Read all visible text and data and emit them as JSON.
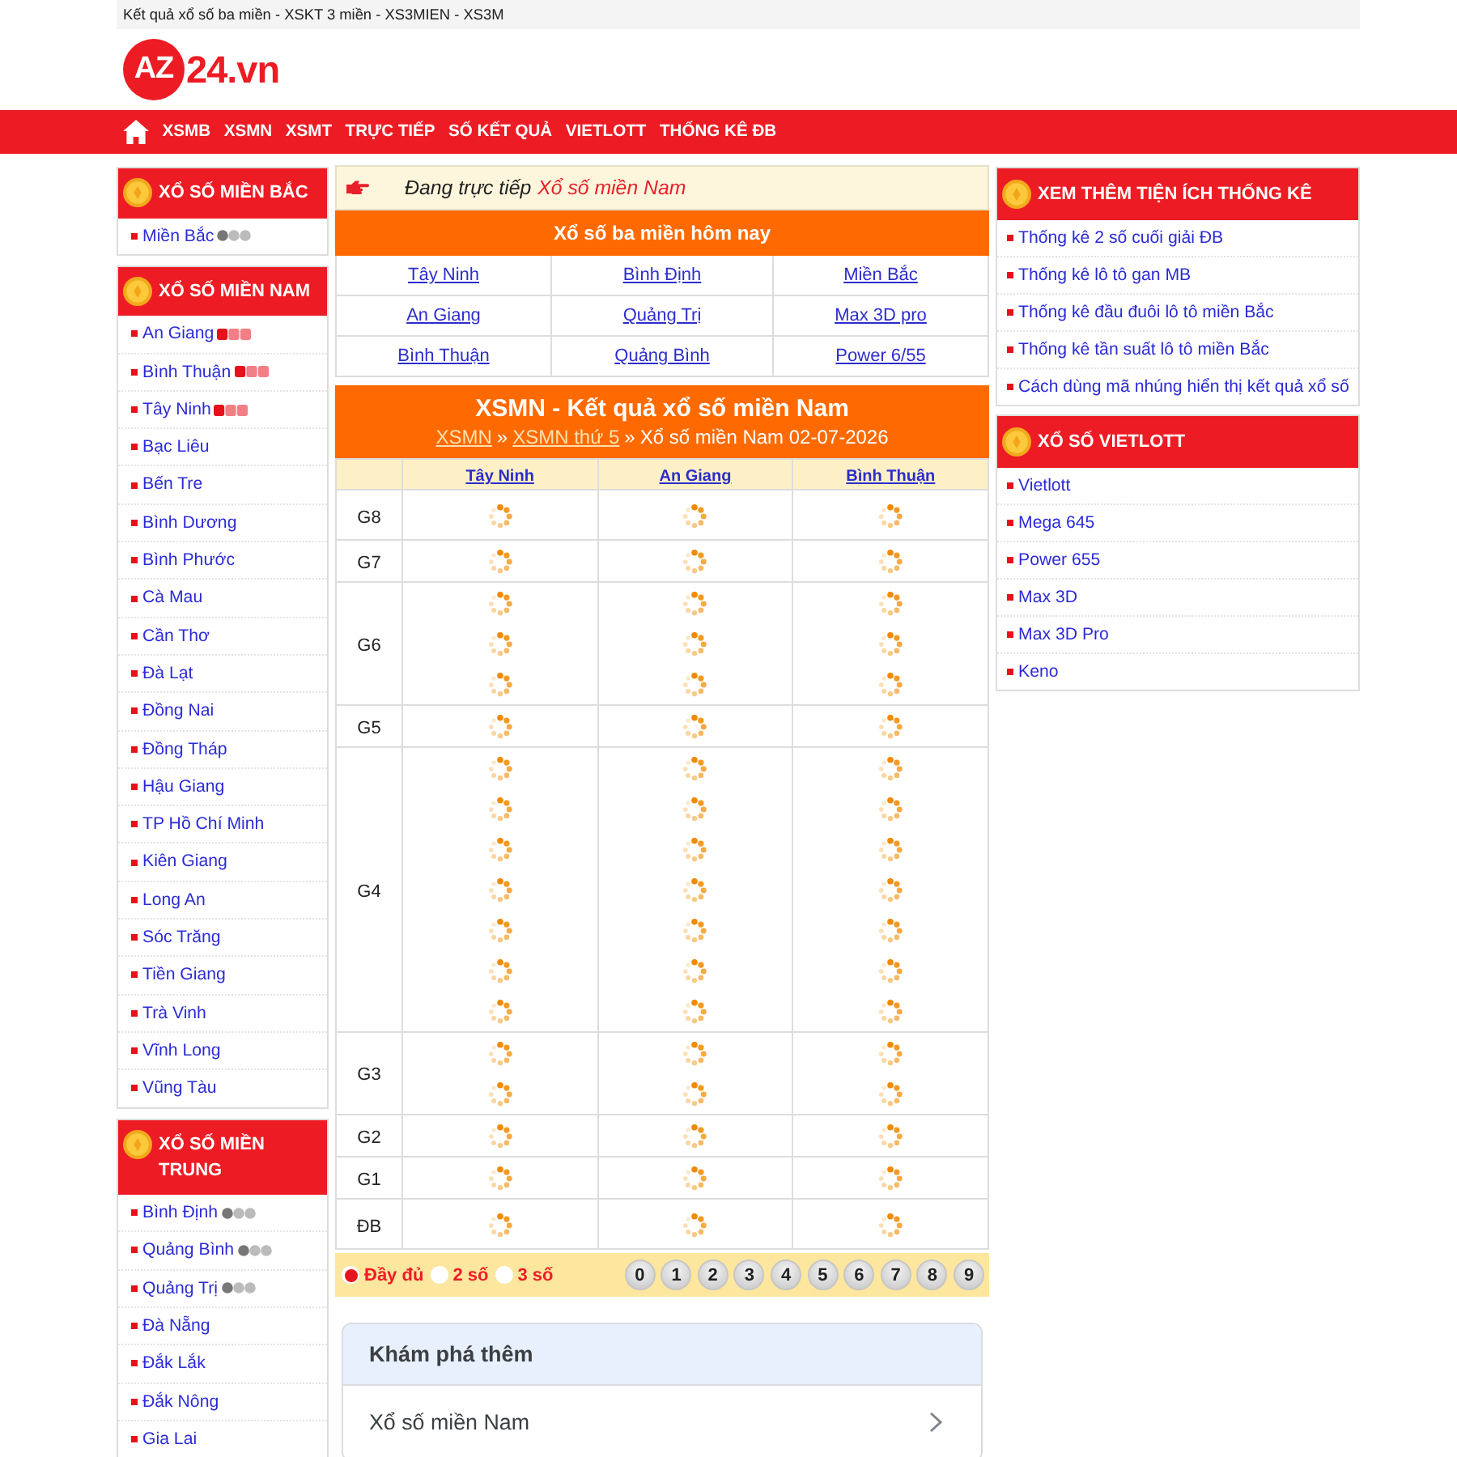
{
  "top_bar": {
    "text": "Kết quả xổ số ba miền - XSKT 3 miền - XS3MIEN - XS3M"
  },
  "logo": {
    "badge": "AZ",
    "text": "24.vn"
  },
  "nav": [
    "XSMB",
    "XSMN",
    "XSMT",
    "TRỰC TIẾP",
    "SỐ KẾT QUẢ",
    "VIETLOTT",
    "THỐNG KÊ ĐB"
  ],
  "left_sidebar": [
    {
      "title": "XỔ SỐ MIỀN BẮC",
      "items": [
        {
          "label": "Miền Bắc",
          "kind": "waiting"
        }
      ]
    },
    {
      "title": "XỔ SỐ MIỀN NAM",
      "items": [
        {
          "label": "An Giang",
          "kind": "live"
        },
        {
          "label": "Bình Thuận",
          "kind": "live"
        },
        {
          "label": "Tây Ninh",
          "kind": "live"
        },
        {
          "label": "Bạc Liêu",
          "kind": "plain"
        },
        {
          "label": "Bến Tre",
          "kind": "plain"
        },
        {
          "label": "Bình Dương",
          "kind": "plain"
        },
        {
          "label": "Bình Phước",
          "kind": "plain"
        },
        {
          "label": "Cà Mau",
          "kind": "plain"
        },
        {
          "label": "Cần Thơ",
          "kind": "plain"
        },
        {
          "label": "Đà Lạt",
          "kind": "plain"
        },
        {
          "label": "Đồng Nai",
          "kind": "plain"
        },
        {
          "label": "Đồng Tháp",
          "kind": "plain"
        },
        {
          "label": "Hậu Giang",
          "kind": "plain"
        },
        {
          "label": "TP Hồ Chí Minh",
          "kind": "plain"
        },
        {
          "label": "Kiên Giang",
          "kind": "plain"
        },
        {
          "label": "Long An",
          "kind": "plain"
        },
        {
          "label": "Sóc Trăng",
          "kind": "plain"
        },
        {
          "label": "Tiền Giang",
          "kind": "plain"
        },
        {
          "label": "Trà Vinh",
          "kind": "plain"
        },
        {
          "label": "Vĩnh Long",
          "kind": "plain"
        },
        {
          "label": "Vũng Tàu",
          "kind": "plain"
        }
      ]
    },
    {
      "title": "XỔ SỐ MIỀN TRUNG",
      "items": [
        {
          "label": "Bình Định",
          "kind": "waiting"
        },
        {
          "label": "Quảng Bình",
          "kind": "waiting"
        },
        {
          "label": "Quảng Trị",
          "kind": "waiting"
        },
        {
          "label": "Đà Nẵng",
          "kind": "plain"
        },
        {
          "label": "Đắk Lắk",
          "kind": "plain"
        },
        {
          "label": "Đắk Nông",
          "kind": "plain"
        },
        {
          "label": "Gia Lai",
          "kind": "plain"
        }
      ]
    }
  ],
  "live_banner": {
    "prefix": "Đang trực tiếp",
    "link": "Xổ số miền Nam"
  },
  "today": {
    "title": "Xổ số ba miền hôm nay",
    "links": [
      "Tây Ninh",
      "Bình Định",
      "Miền Bắc",
      "An Giang",
      "Quảng Trị",
      "Max 3D pro",
      "Bình Thuận",
      "Quảng Bình",
      "Power 6/55"
    ]
  },
  "results": {
    "title": "XSMN - Kết quả xổ số miền Nam",
    "breadcrumb": [
      {
        "kind": "link",
        "label": "XSMN"
      },
      {
        "kind": "separator",
        "label": "»"
      },
      {
        "kind": "link",
        "label": "XSMN thứ 5"
      },
      {
        "kind": "separator",
        "label": "»"
      },
      {
        "kind": "text",
        "label": "Xổ số miền Nam 02-07-2026"
      }
    ],
    "columns": [
      "Tây Ninh",
      "An Giang",
      "Bình Thuận"
    ],
    "prizes": [
      {
        "label": "G8",
        "cells": [
          {
            "slots": [
              {
                "loading": true
              }
            ]
          },
          {
            "slots": [
              {
                "loading": true
              }
            ]
          },
          {
            "slots": [
              {
                "loading": true
              }
            ]
          }
        ]
      },
      {
        "label": "G7",
        "cells": [
          {
            "slots": [
              {
                "loading": true
              }
            ]
          },
          {
            "slots": [
              {
                "loading": true
              }
            ]
          },
          {
            "slots": [
              {
                "loading": true
              }
            ]
          }
        ]
      },
      {
        "label": "G6",
        "cells": [
          {
            "slots": [
              {
                "loading": true
              },
              {
                "loading": true
              },
              {
                "loading": true
              }
            ]
          },
          {
            "slots": [
              {
                "loading": true
              },
              {
                "loading": true
              },
              {
                "loading": true
              }
            ]
          },
          {
            "slots": [
              {
                "loading": true
              },
              {
                "loading": true
              },
              {
                "loading": true
              }
            ]
          }
        ]
      },
      {
        "label": "G5",
        "cells": [
          {
            "slots": [
              {
                "loading": true
              }
            ]
          },
          {
            "slots": [
              {
                "loading": true
              }
            ]
          },
          {
            "slots": [
              {
                "loading": true
              }
            ]
          }
        ]
      },
      {
        "label": "G4",
        "cells": [
          {
            "slots": [
              {
                "loading": true
              },
              {
                "loading": true
              },
              {
                "loading": true
              },
              {
                "loading": true
              },
              {
                "loading": true
              },
              {
                "loading": true
              },
              {
                "loading": true
              }
            ]
          },
          {
            "slots": [
              {
                "loading": true
              },
              {
                "loading": true
              },
              {
                "loading": true
              },
              {
                "loading": true
              },
              {
                "loading": true
              },
              {
                "loading": true
              },
              {
                "loading": true
              }
            ]
          },
          {
            "slots": [
              {
                "loading": true
              },
              {
                "loading": true
              },
              {
                "loading": true
              },
              {
                "loading": true
              },
              {
                "loading": true
              },
              {
                "loading": true
              },
              {
                "loading": true
              }
            ]
          }
        ]
      },
      {
        "label": "G3",
        "cells": [
          {
            "slots": [
              {
                "loading": true
              },
              {
                "loading": true
              }
            ]
          },
          {
            "slots": [
              {
                "loading": true
              },
              {
                "loading": true
              }
            ]
          },
          {
            "slots": [
              {
                "loading": true
              },
              {
                "loading": true
              }
            ]
          }
        ]
      },
      {
        "label": "G2",
        "cells": [
          {
            "slots": [
              {
                "loading": true
              }
            ]
          },
          {
            "slots": [
              {
                "loading": true
              }
            ]
          },
          {
            "slots": [
              {
                "loading": true
              }
            ]
          }
        ]
      },
      {
        "label": "G1",
        "cells": [
          {
            "slots": [
              {
                "loading": true
              }
            ]
          },
          {
            "slots": [
              {
                "loading": true
              }
            ]
          },
          {
            "slots": [
              {
                "loading": true
              }
            ]
          }
        ]
      },
      {
        "label": "ĐB",
        "cells": [
          {
            "slots": [
              {
                "loading": true
              }
            ]
          },
          {
            "slots": [
              {
                "loading": true
              }
            ]
          },
          {
            "slots": [
              {
                "loading": true
              }
            ]
          }
        ]
      }
    ]
  },
  "controls": {
    "modes": [
      {
        "label": "Đầy đủ",
        "selected": true
      },
      {
        "label": "2 số",
        "selected": false
      },
      {
        "label": "3 số",
        "selected": false
      }
    ],
    "digits": [
      "0",
      "1",
      "2",
      "3",
      "4",
      "5",
      "6",
      "7",
      "8",
      "9"
    ]
  },
  "explore": {
    "title": "Khám phá thêm",
    "items": [
      "Xổ số miền Nam"
    ]
  },
  "right_sidebar": [
    {
      "title": "XEM THÊM TIỆN ÍCH THỐNG KÊ",
      "items": [
        {
          "label": "Thống kê 2 số cuối giải ĐB"
        },
        {
          "label": "Thống kê lô tô gan MB"
        },
        {
          "label": "Thống kê đầu đuôi lô tô miền Bắc"
        },
        {
          "label": "Thống kê tần suất lô tô miền Bắc"
        },
        {
          "label": "Cách dùng mã nhúng hiển thị kết quả xổ số"
        }
      ]
    },
    {
      "title": "XỔ SỐ VIETLOTT",
      "items": [
        {
          "label": "Vietlott"
        },
        {
          "label": "Mega 645"
        },
        {
          "label": "Power 655"
        },
        {
          "label": "Max 3D"
        },
        {
          "label": "Max 3D Pro"
        },
        {
          "label": "Keno"
        }
      ]
    }
  ]
}
